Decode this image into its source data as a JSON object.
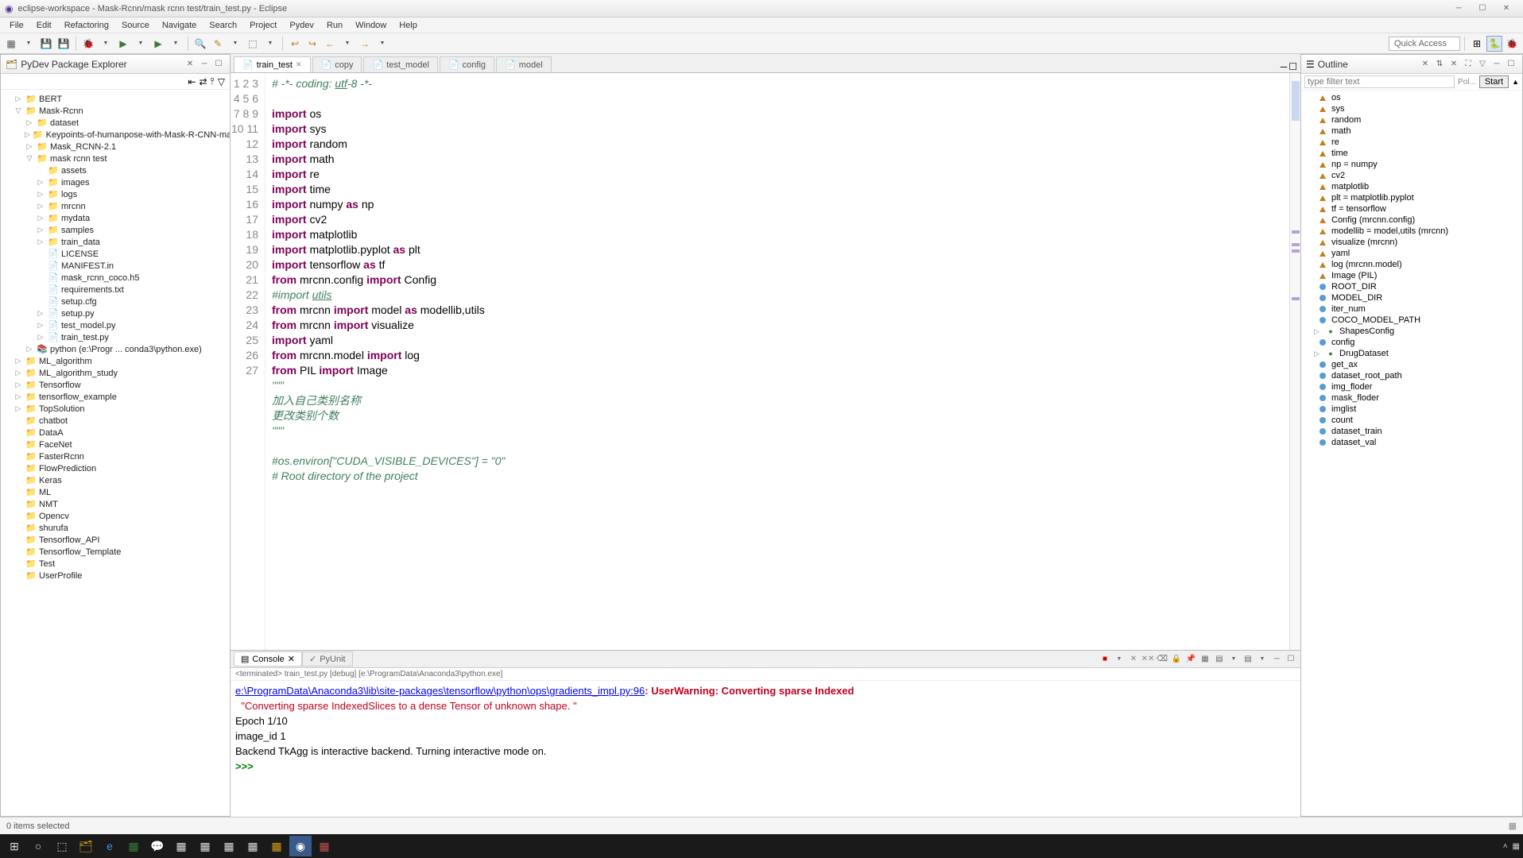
{
  "window": {
    "title": "eclipse-workspace - Mask-Rcnn/mask rcnn test/train_test.py - Eclipse"
  },
  "menu": [
    "File",
    "Edit",
    "Refactoring",
    "Source",
    "Navigate",
    "Search",
    "Project",
    "Pydev",
    "Run",
    "Window",
    "Help"
  ],
  "toolbar": {
    "quick_access": "Quick Access"
  },
  "package_explorer": {
    "title": "PyDev Package Explorer",
    "items": [
      {
        "label": "BERT",
        "depth": 1,
        "arrow": "▷",
        "icon": "📁"
      },
      {
        "label": "Mask-Rcnn",
        "depth": 1,
        "arrow": "▽",
        "icon": "📁"
      },
      {
        "label": "dataset",
        "depth": 2,
        "arrow": "▷",
        "icon": "📁"
      },
      {
        "label": "Keypoints-of-humanpose-with-Mask-R-CNN-master",
        "depth": 2,
        "arrow": "▷",
        "icon": "📁"
      },
      {
        "label": "Mask_RCNN-2.1",
        "depth": 2,
        "arrow": "▷",
        "icon": "📁"
      },
      {
        "label": "mask rcnn test",
        "depth": 2,
        "arrow": "▽",
        "icon": "📁"
      },
      {
        "label": "assets",
        "depth": 3,
        "arrow": "",
        "icon": "📁"
      },
      {
        "label": "images",
        "depth": 3,
        "arrow": "▷",
        "icon": "📁"
      },
      {
        "label": "logs",
        "depth": 3,
        "arrow": "▷",
        "icon": "📁"
      },
      {
        "label": "mrcnn",
        "depth": 3,
        "arrow": "▷",
        "icon": "📁"
      },
      {
        "label": "mydata",
        "depth": 3,
        "arrow": "▷",
        "icon": "📁"
      },
      {
        "label": "samples",
        "depth": 3,
        "arrow": "▷",
        "icon": "📁"
      },
      {
        "label": "train_data",
        "depth": 3,
        "arrow": "▷",
        "icon": "📁"
      },
      {
        "label": "LICENSE",
        "depth": 3,
        "arrow": "",
        "icon": "📄"
      },
      {
        "label": "MANIFEST.in",
        "depth": 3,
        "arrow": "",
        "icon": "📄"
      },
      {
        "label": "mask_rcnn_coco.h5",
        "depth": 3,
        "arrow": "",
        "icon": "📄"
      },
      {
        "label": "requirements.txt",
        "depth": 3,
        "arrow": "",
        "icon": "📄"
      },
      {
        "label": "setup.cfg",
        "depth": 3,
        "arrow": "",
        "icon": "📄"
      },
      {
        "label": "setup.py",
        "depth": 3,
        "arrow": "▷",
        "icon": "📄"
      },
      {
        "label": "test_model.py",
        "depth": 3,
        "arrow": "▷",
        "icon": "📄"
      },
      {
        "label": "train_test.py",
        "depth": 3,
        "arrow": "▷",
        "icon": "📄"
      },
      {
        "label": "python  (e:\\Progr ... conda3\\python.exe)",
        "depth": 2,
        "arrow": "▷",
        "icon": "📚"
      },
      {
        "label": "ML_algorithm",
        "depth": 1,
        "arrow": "▷",
        "icon": "📁"
      },
      {
        "label": "ML_algorithm_study",
        "depth": 1,
        "arrow": "▷",
        "icon": "📁"
      },
      {
        "label": "Tensorflow",
        "depth": 1,
        "arrow": "▷",
        "icon": "📁"
      },
      {
        "label": "tensorflow_example",
        "depth": 1,
        "arrow": "▷",
        "icon": "📁"
      },
      {
        "label": "TopSolution",
        "depth": 1,
        "arrow": "▷",
        "icon": "📁"
      },
      {
        "label": "chatbot",
        "depth": 1,
        "arrow": "",
        "icon": "📁"
      },
      {
        "label": "DataA",
        "depth": 1,
        "arrow": "",
        "icon": "📁"
      },
      {
        "label": "FaceNet",
        "depth": 1,
        "arrow": "",
        "icon": "📁"
      },
      {
        "label": "FasterRcnn",
        "depth": 1,
        "arrow": "",
        "icon": "📁"
      },
      {
        "label": "FlowPrediction",
        "depth": 1,
        "arrow": "",
        "icon": "📁"
      },
      {
        "label": "Keras",
        "depth": 1,
        "arrow": "",
        "icon": "📁"
      },
      {
        "label": "ML",
        "depth": 1,
        "arrow": "",
        "icon": "📁"
      },
      {
        "label": "NMT",
        "depth": 1,
        "arrow": "",
        "icon": "📁"
      },
      {
        "label": "Opencv",
        "depth": 1,
        "arrow": "",
        "icon": "📁"
      },
      {
        "label": "shurufa",
        "depth": 1,
        "arrow": "",
        "icon": "📁"
      },
      {
        "label": "Tensorflow_API",
        "depth": 1,
        "arrow": "",
        "icon": "📁"
      },
      {
        "label": "Tensorflow_Template",
        "depth": 1,
        "arrow": "",
        "icon": "📁"
      },
      {
        "label": "Test",
        "depth": 1,
        "arrow": "",
        "icon": "📁"
      },
      {
        "label": "UserProfile",
        "depth": 1,
        "arrow": "",
        "icon": "📁"
      }
    ]
  },
  "editor": {
    "tabs": [
      {
        "label": "train_test",
        "active": true
      },
      {
        "label": "copy",
        "active": false
      },
      {
        "label": "test_model",
        "active": false
      },
      {
        "label": "config",
        "active": false
      },
      {
        "label": "model",
        "active": false
      }
    ],
    "lines": [
      {
        "n": 1,
        "html": "<span class='cmt'># -*- coding: <u>utf</u>-8 -*-</span>"
      },
      {
        "n": 2,
        "html": ""
      },
      {
        "n": 3,
        "html": "<span class='kw'>import</span> os"
      },
      {
        "n": 4,
        "html": "<span class='kw'>import</span> sys"
      },
      {
        "n": 5,
        "html": "<span class='kw'>import</span> random"
      },
      {
        "n": 6,
        "html": "<span class='kw'>import</span> math"
      },
      {
        "n": 7,
        "html": "<span class='kw'>import</span> re"
      },
      {
        "n": 8,
        "html": "<span class='kw'>import</span> time"
      },
      {
        "n": 9,
        "html": "<span class='kw'>import</span> numpy <span class='kw'>as</span> np"
      },
      {
        "n": 10,
        "html": "<span class='kw'>import</span> cv2"
      },
      {
        "n": 11,
        "html": "<span class='kw'>import</span> matplotlib"
      },
      {
        "n": 12,
        "html": "<span class='kw'>import</span> matplotlib.pyplot <span class='kw'>as</span> plt"
      },
      {
        "n": 13,
        "html": "<span class='kw'>import</span> tensorflow <span class='kw'>as</span> tf"
      },
      {
        "n": 14,
        "html": "<span class='kw'>from</span> mrcnn.config <span class='kw'>import</span> Config"
      },
      {
        "n": 15,
        "html": "<span class='cmt'>#import <u>utils</u></span>"
      },
      {
        "n": 16,
        "html": "<span class='kw'>from</span> mrcnn <span class='kw'>import</span> model <span class='kw'>as</span> modellib,utils"
      },
      {
        "n": 17,
        "html": "<span class='kw'>from</span> mrcnn <span class='kw'>import</span> visualize"
      },
      {
        "n": 18,
        "html": "<span class='kw'>import</span> yaml"
      },
      {
        "n": 19,
        "html": "<span class='kw'>from</span> mrcnn.model <span class='kw'>import</span> log"
      },
      {
        "n": 20,
        "html": "<span class='kw'>from</span> PIL <span class='kw'>import</span> Image"
      },
      {
        "n": 21,
        "html": "<span class='cmt'>\"\"\"</span>"
      },
      {
        "n": 22,
        "html": "<span class='cmt'>加入自己类别名称</span>"
      },
      {
        "n": 23,
        "html": "<span class='cmt'>更改类别个数</span>"
      },
      {
        "n": 24,
        "html": "<span class='cmt'>\"\"\"</span>"
      },
      {
        "n": 25,
        "html": ""
      },
      {
        "n": 26,
        "html": "<span class='cmt'>#os.environ[\"CUDA_VISIBLE_DEVICES\"] = \"0\"</span>"
      },
      {
        "n": 27,
        "html": "<span class='cmt'># Root directory of the project</span>"
      }
    ]
  },
  "console": {
    "tab1": "Console",
    "tab2": "PyUnit",
    "header": "<terminated> train_test.py [debug] [e:\\ProgramData\\Anaconda3\\python.exe]",
    "line1_link": "e:\\ProgramData\\Anaconda3\\lib\\site-packages\\tensorflow\\python\\ops\\gradients_impl.py:96",
    "line1_warn": ": UserWarning: Converting sparse Indexed",
    "line2": "  \"Converting sparse IndexedSlices to a dense Tensor of unknown shape. \"",
    "line3": "Epoch 1/10",
    "line4": "image_id 1",
    "line5": "Backend TkAgg is interactive backend. Turning interactive mode on.",
    "prompt": ">>> "
  },
  "outline": {
    "title": "Outline",
    "filter_placeholder": "type filter text",
    "pol": "Pol...",
    "start": "Start",
    "items": [
      {
        "label": "os",
        "type": "imp"
      },
      {
        "label": "sys",
        "type": "imp"
      },
      {
        "label": "random",
        "type": "imp"
      },
      {
        "label": "math",
        "type": "imp"
      },
      {
        "label": "re",
        "type": "imp"
      },
      {
        "label": "time",
        "type": "imp"
      },
      {
        "label": "np = numpy",
        "type": "imp"
      },
      {
        "label": "cv2",
        "type": "imp"
      },
      {
        "label": "matplotlib",
        "type": "imp"
      },
      {
        "label": "plt = matplotlib.pyplot",
        "type": "imp"
      },
      {
        "label": "tf = tensorflow",
        "type": "imp"
      },
      {
        "label": "Config (mrcnn.config)",
        "type": "imp"
      },
      {
        "label": "modellib = model,utils (mrcnn)",
        "type": "imp"
      },
      {
        "label": "visualize (mrcnn)",
        "type": "imp"
      },
      {
        "label": "yaml",
        "type": "imp"
      },
      {
        "label": "log (mrcnn.model)",
        "type": "imp"
      },
      {
        "label": "Image (PIL)",
        "type": "imp"
      },
      {
        "label": "ROOT_DIR",
        "type": "var"
      },
      {
        "label": "MODEL_DIR",
        "type": "var"
      },
      {
        "label": "iter_num",
        "type": "var"
      },
      {
        "label": "COCO_MODEL_PATH",
        "type": "var"
      },
      {
        "label": "ShapesConfig",
        "type": "cls"
      },
      {
        "label": "config",
        "type": "var"
      },
      {
        "label": "DrugDataset",
        "type": "cls"
      },
      {
        "label": "get_ax",
        "type": "var"
      },
      {
        "label": "dataset_root_path",
        "type": "var"
      },
      {
        "label": "img_floder",
        "type": "var"
      },
      {
        "label": "mask_floder",
        "type": "var"
      },
      {
        "label": "imglist",
        "type": "var"
      },
      {
        "label": "count",
        "type": "var"
      },
      {
        "label": "dataset_train",
        "type": "var"
      },
      {
        "label": "dataset_val",
        "type": "var"
      }
    ]
  },
  "statusbar": {
    "text": "0 items selected"
  }
}
